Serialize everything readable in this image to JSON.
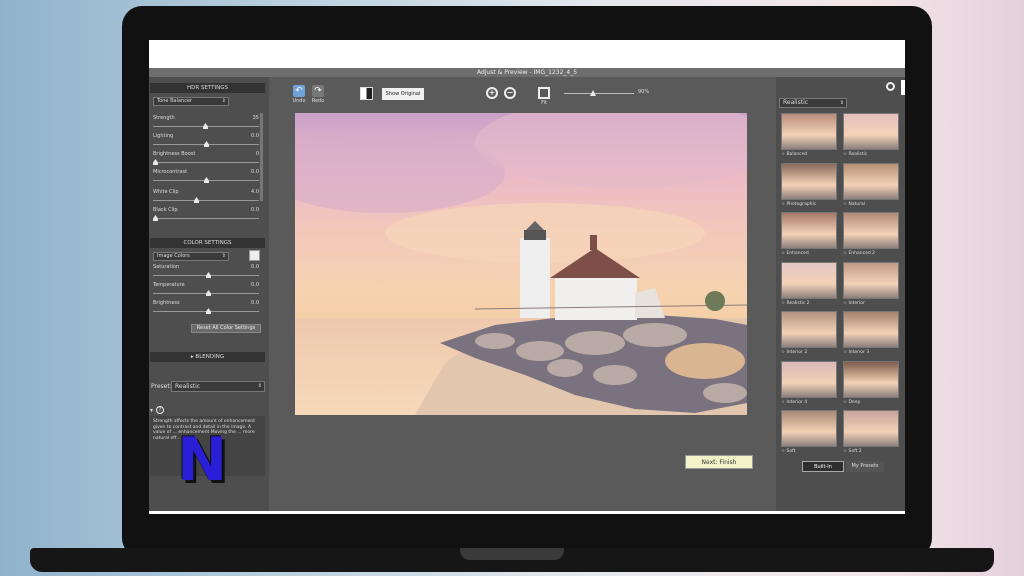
{
  "window_title": "Adjust & Preview - IMG_1232_4_5",
  "hdr": {
    "title": "HDR SETTINGS",
    "mode": "Tone Balancer",
    "sliders": [
      {
        "label": "Strength",
        "value": "35"
      },
      {
        "label": "Lighting",
        "value": "0.0"
      },
      {
        "label": "Brightness Boost",
        "value": "0"
      },
      {
        "label": "Microcontrast",
        "value": "0.0"
      },
      {
        "label": "White Clip",
        "value": "4.0"
      },
      {
        "label": "Black Clip",
        "value": "0.0"
      }
    ]
  },
  "color": {
    "title": "COLOR SETTINGS",
    "mode": "Image Colors",
    "sliders": [
      {
        "label": "Saturation",
        "value": "0.0"
      },
      {
        "label": "Temperature",
        "value": "0.0"
      },
      {
        "label": "Brightness",
        "value": "0.0"
      }
    ],
    "reset_label": "Reset All Color Settings"
  },
  "blending": {
    "title": "BLENDING"
  },
  "preset_row": {
    "label": "Preset:",
    "value": "Realistic"
  },
  "help_text": "Strength affects the amount of enhancement given to contrast and detail in the image. A value of ... enhancement Moving the ... more natural eff...",
  "toolbar": {
    "undo": "Undo",
    "redo": "Redo",
    "show_original": "Show Original",
    "fit": "Fit",
    "zoom": "90%"
  },
  "next_button": "Next: Finish",
  "right": {
    "dropdown": "Realistic",
    "presets": [
      "Balanced",
      "Realistic",
      "Photographic",
      "Natural",
      "Enhanced",
      "Enhanced 2",
      "Realistic 2",
      "Interior",
      "Interior 2",
      "Interior 3",
      "Interior 4",
      "Deep",
      "Soft",
      "Soft 2"
    ],
    "tabs": [
      "Built-In",
      "My Presets"
    ]
  },
  "logo_text": "N",
  "colors": {
    "accent": "#6fa3d8",
    "panel": "#4e4e4e",
    "next_button": "#f2f3c8"
  }
}
